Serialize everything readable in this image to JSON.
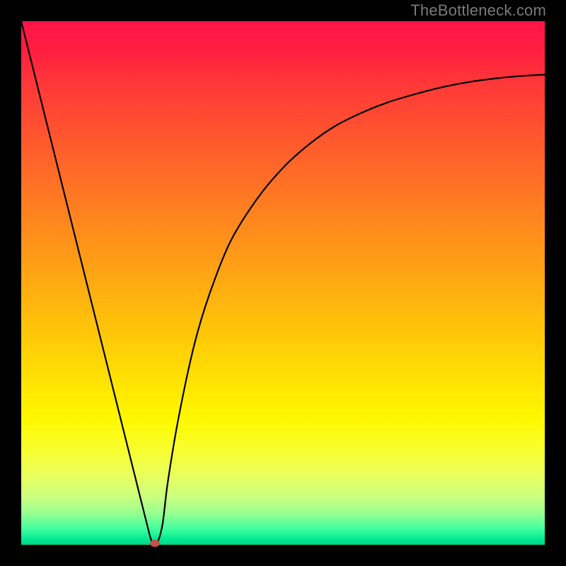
{
  "watermark": "TheBottleneck.com",
  "colors": {
    "page_bg": "#000000",
    "curve": "#000000",
    "marker": "#c85048",
    "watermark_text": "#7a7a7a"
  },
  "chart_data": {
    "type": "line",
    "title": "",
    "xlabel": "",
    "ylabel": "",
    "xlim": [
      0,
      100
    ],
    "ylim": [
      0,
      100
    ],
    "grid": false,
    "series": [
      {
        "name": "curve",
        "x": [
          0,
          5,
          10,
          15,
          20,
          22,
          24,
          25,
          26,
          27,
          28,
          30,
          33,
          36,
          40,
          45,
          50,
          55,
          60,
          65,
          70,
          75,
          80,
          85,
          90,
          95,
          100
        ],
        "y": [
          100,
          80,
          60,
          40,
          20,
          12,
          4,
          0.5,
          0.5,
          4,
          12,
          24,
          38,
          48,
          58,
          66,
          72,
          76.5,
          80,
          82.5,
          84.5,
          86,
          87.3,
          88.3,
          89,
          89.5,
          89.8
        ]
      }
    ],
    "marker": {
      "x": 25.5,
      "y": 0.3
    },
    "gradient_stops": [
      {
        "pct": 0,
        "color": "#ff1448"
      },
      {
        "pct": 20,
        "color": "#ff5030"
      },
      {
        "pct": 40,
        "color": "#ff9818"
      },
      {
        "pct": 60,
        "color": "#ffc808"
      },
      {
        "pct": 80,
        "color": "#f8ff30"
      },
      {
        "pct": 95,
        "color": "#40ffa0"
      },
      {
        "pct": 100,
        "color": "#00d488"
      }
    ]
  }
}
